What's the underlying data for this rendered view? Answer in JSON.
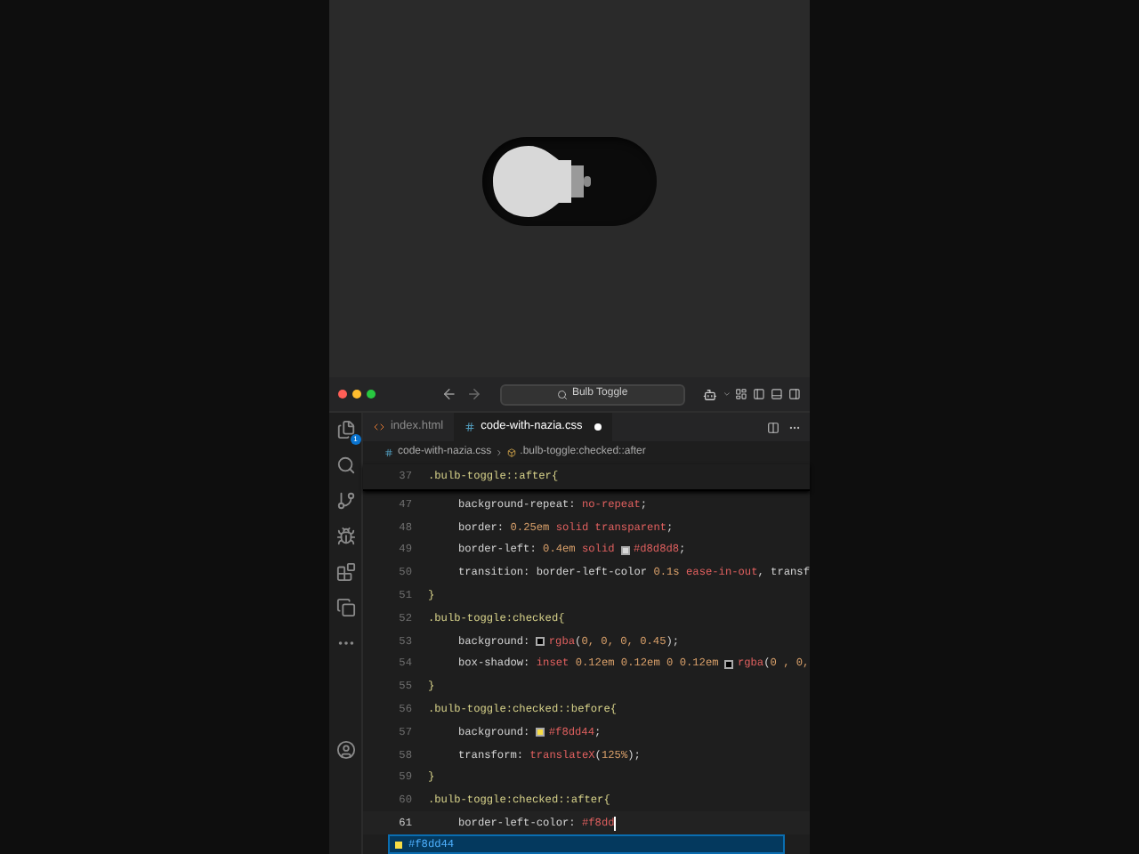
{
  "preview": {
    "toggle": {
      "checked": false
    }
  },
  "title_bar": {
    "search": "Bulb Toggle"
  },
  "activity_bar": {
    "badge": "1"
  },
  "tabs": [
    {
      "label": "index.html",
      "kind": "html",
      "selected": false,
      "modified": false
    },
    {
      "label": "code-with-nazia.css",
      "kind": "css",
      "selected": true,
      "modified": true
    }
  ],
  "breadcrumb": {
    "file": "code-with-nazia.css",
    "symbol": ".bulb-toggle:checked::after"
  },
  "sticky_line": {
    "number": "37",
    "segments": [
      {
        "text": ".bulb-toggle::after{",
        "kind": "sel"
      }
    ]
  },
  "lines": [
    {
      "number": "47",
      "kind": "declaration",
      "active": false,
      "segments": [
        {
          "text": "background-repeat: ",
          "kind": "prop"
        },
        {
          "text": "no-repeat",
          "kind": "val"
        },
        {
          "text": ";",
          "kind": "punct"
        }
      ]
    },
    {
      "number": "48",
      "kind": "declaration",
      "active": false,
      "segments": [
        {
          "text": "border: ",
          "kind": "prop"
        },
        {
          "text": "0.25em ",
          "kind": "num"
        },
        {
          "text": "solid transparent",
          "kind": "val"
        },
        {
          "text": ";",
          "kind": "punct"
        }
      ]
    },
    {
      "number": "49",
      "kind": "declaration",
      "active": false,
      "segments": [
        {
          "text": "border-left: ",
          "kind": "prop"
        },
        {
          "text": "0.4em ",
          "kind": "num"
        },
        {
          "text": "solid ",
          "kind": "val"
        },
        {
          "kind": "swatch",
          "color": "#d8d8d8"
        },
        {
          "text": "#d8d8d8",
          "kind": "val"
        },
        {
          "text": ";",
          "kind": "punct"
        }
      ]
    },
    {
      "number": "50",
      "kind": "declaration",
      "active": false,
      "segments": [
        {
          "text": "transition: border-left-color ",
          "kind": "prop"
        },
        {
          "text": "0.1s ",
          "kind": "num"
        },
        {
          "text": "ease-in-out",
          "kind": "val"
        },
        {
          "text": ", transf",
          "kind": "prop"
        }
      ]
    },
    {
      "number": "51",
      "kind": "close",
      "active": false,
      "segments": [
        {
          "text": "}",
          "kind": "sel"
        }
      ]
    },
    {
      "number": "52",
      "kind": "selector",
      "active": false,
      "segments": [
        {
          "text": ".bulb-toggle:checked{",
          "kind": "sel"
        }
      ]
    },
    {
      "number": "53",
      "kind": "declaration",
      "active": false,
      "segments": [
        {
          "text": "background: ",
          "kind": "prop"
        },
        {
          "kind": "swatch",
          "color": "#000000"
        },
        {
          "text": "rgba",
          "kind": "val"
        },
        {
          "text": "(",
          "kind": "punct"
        },
        {
          "text": "0, 0, 0, 0.45",
          "kind": "num"
        },
        {
          "text": ");",
          "kind": "punct"
        }
      ]
    },
    {
      "number": "54",
      "kind": "declaration",
      "active": false,
      "segments": [
        {
          "text": "box-shadow: ",
          "kind": "prop"
        },
        {
          "text": "inset ",
          "kind": "val"
        },
        {
          "text": "0.12em 0.12em 0 0.12em ",
          "kind": "num"
        },
        {
          "kind": "swatch",
          "color": "#000000"
        },
        {
          "text": "rgba",
          "kind": "val"
        },
        {
          "text": "(",
          "kind": "punct"
        },
        {
          "text": "0 , 0,",
          "kind": "num"
        }
      ]
    },
    {
      "number": "55",
      "kind": "close",
      "active": false,
      "segments": [
        {
          "text": "}",
          "kind": "sel"
        }
      ]
    },
    {
      "number": "56",
      "kind": "selector",
      "active": false,
      "segments": [
        {
          "text": ".bulb-toggle:checked::before{",
          "kind": "sel"
        }
      ]
    },
    {
      "number": "57",
      "kind": "declaration",
      "active": false,
      "segments": [
        {
          "text": "background: ",
          "kind": "prop"
        },
        {
          "kind": "swatch",
          "color": "#f8dd44"
        },
        {
          "text": "#f8dd44",
          "kind": "val"
        },
        {
          "text": ";",
          "kind": "punct"
        }
      ]
    },
    {
      "number": "58",
      "kind": "declaration",
      "active": false,
      "segments": [
        {
          "text": "transform: ",
          "kind": "prop"
        },
        {
          "text": "translateX",
          "kind": "val"
        },
        {
          "text": "(",
          "kind": "punct"
        },
        {
          "text": "125%",
          "kind": "num"
        },
        {
          "text": ");",
          "kind": "punct"
        }
      ]
    },
    {
      "number": "59",
      "kind": "close",
      "active": false,
      "segments": [
        {
          "text": "}",
          "kind": "sel"
        }
      ]
    },
    {
      "number": "60",
      "kind": "selector",
      "active": false,
      "segments": [
        {
          "text": ".bulb-toggle:checked::after{",
          "kind": "sel"
        }
      ]
    },
    {
      "number": "61",
      "kind": "declaration",
      "active": true,
      "segments": [
        {
          "text": "border-left-color: ",
          "kind": "prop"
        },
        {
          "text": "#f8dd",
          "kind": "val"
        }
      ]
    }
  ],
  "suggestion": {
    "text": "#f8dd44",
    "color": "#f8dd44"
  }
}
